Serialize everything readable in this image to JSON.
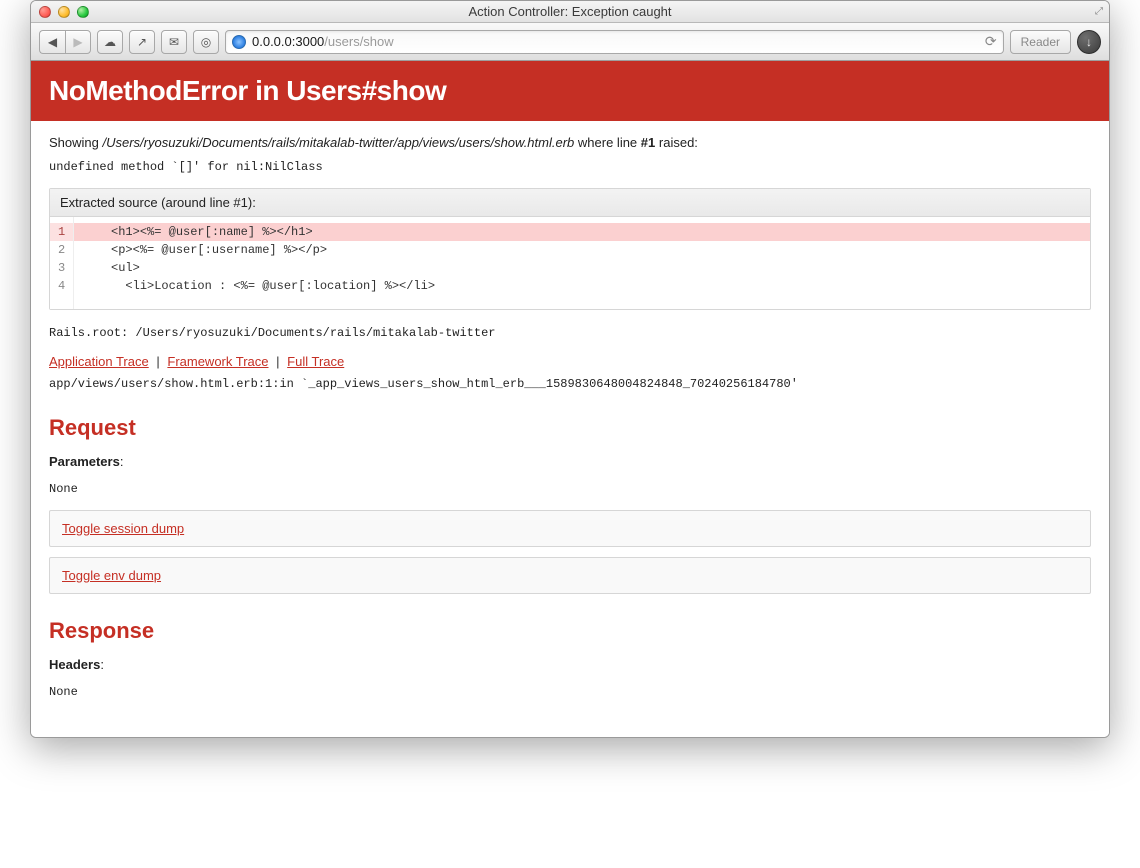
{
  "window": {
    "title": "Action Controller: Exception caught"
  },
  "address": {
    "host": "0.0.0.0:3000",
    "path": "/users/show"
  },
  "toolbar": {
    "reader_label": "Reader"
  },
  "error": {
    "title": "NoMethodError in Users#show",
    "showing_prefix": "Showing",
    "showing_path": "/Users/ryosuzuki/Documents/rails/mitakalab-twitter/app/views/users/show.html.erb",
    "showing_middle": "where line",
    "showing_line_label": "#1",
    "showing_suffix": "raised:",
    "message": "undefined method `[]' for nil:NilClass",
    "extracted_label": "Extracted source (around line #1):",
    "rails_root": "Rails.root: /Users/ryosuzuki/Documents/rails/mitakalab-twitter",
    "trace_links": {
      "application": "Application Trace",
      "framework": "Framework Trace",
      "full": "Full Trace"
    },
    "trace_line": "app/views/users/show.html.erb:1:in `_app_views_users_show_html_erb___1589830648004824848_70240256184780'"
  },
  "source": {
    "lines": [
      {
        "num": "1",
        "code": "    <h1><%= @user[:name] %></h1>",
        "hl": true
      },
      {
        "num": "2",
        "code": "    <p><%= @user[:username] %></p>",
        "hl": false
      },
      {
        "num": "3",
        "code": "    <ul>",
        "hl": false
      },
      {
        "num": "4",
        "code": "      <li>Location : <%= @user[:location] %></li>",
        "hl": false
      }
    ]
  },
  "request": {
    "heading": "Request",
    "parameters_label": "Parameters",
    "parameters_value": "None",
    "toggle_session": "Toggle session dump",
    "toggle_env": "Toggle env dump"
  },
  "response": {
    "heading": "Response",
    "headers_label": "Headers",
    "headers_value": "None"
  }
}
